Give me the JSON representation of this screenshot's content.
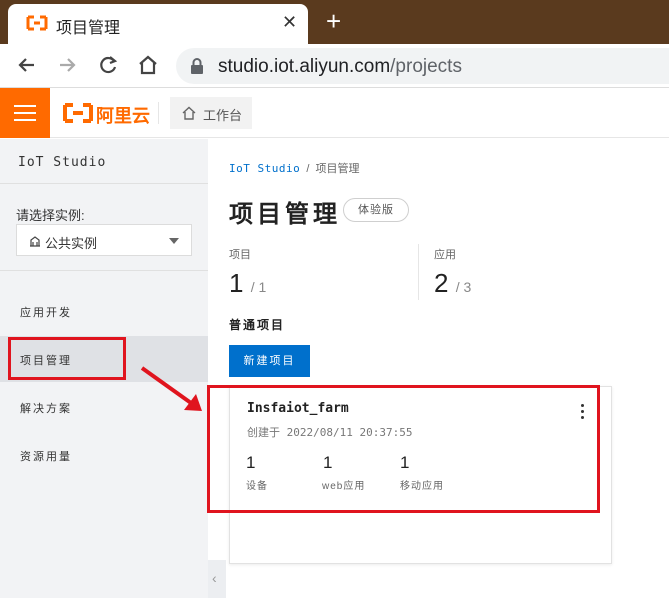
{
  "browser": {
    "tab_title": "项目管理",
    "close_glyph": "✕",
    "new_tab_glyph": "+",
    "url_host": "studio.iot.aliyun.com",
    "url_path": "/projects"
  },
  "header": {
    "brand": "阿里云",
    "brand_color": "#ff6a00",
    "workbench_label": "工作台"
  },
  "sidebar": {
    "title": "IoT Studio",
    "instance_label": "请选择实例:",
    "instance_value": "公共实例",
    "items": [
      {
        "label": "应用开发",
        "active": false
      },
      {
        "label": "项目管理",
        "active": true
      },
      {
        "label": "解决方案",
        "active": false
      },
      {
        "label": "资源用量",
        "active": false
      }
    ],
    "collapse_glyph": "‹"
  },
  "main": {
    "breadcrumb": {
      "root": "IoT Studio",
      "separator": "/",
      "current": "项目管理"
    },
    "title": "项目管理",
    "badge": "体验版",
    "stats": [
      {
        "label": "项目",
        "value": "1",
        "total": "/ 1"
      },
      {
        "label": "应用",
        "value": "2",
        "total": "/ 3"
      }
    ],
    "section_title": "普通项目",
    "new_button": "新建项目",
    "button_color": "#0070cc",
    "project": {
      "name": "Insfaiot_farm",
      "created": "创建于 2022/08/11 20:37:55",
      "metrics": [
        {
          "value": "1",
          "label": "设备"
        },
        {
          "value": "1",
          "label": "web应用"
        },
        {
          "value": "1",
          "label": "移动应用"
        }
      ]
    }
  },
  "annotation_color": "#e0141e"
}
